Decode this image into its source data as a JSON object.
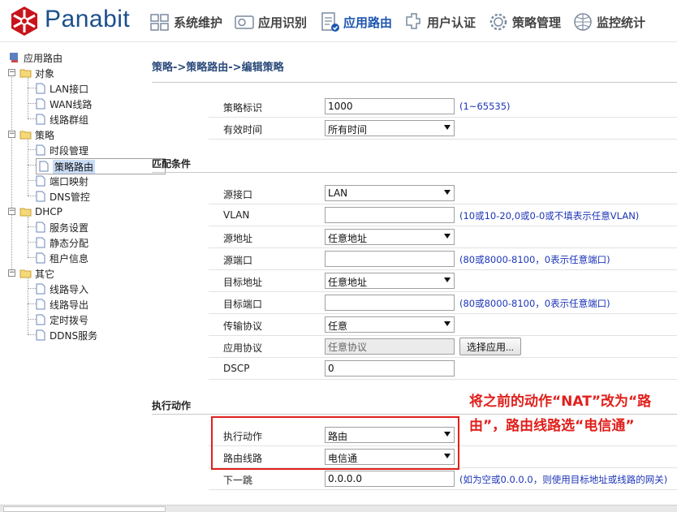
{
  "header": {
    "brand": "Panabit",
    "nav": [
      {
        "label": "系统维护",
        "icon": "system-icon"
      },
      {
        "label": "应用识别",
        "icon": "app-recognition-icon"
      },
      {
        "label": "应用路由",
        "icon": "app-routing-icon",
        "active": true
      },
      {
        "label": "用户认证",
        "icon": "user-auth-icon"
      },
      {
        "label": "策略管理",
        "icon": "policy-gear-icon"
      },
      {
        "label": "监控统计",
        "icon": "monitor-icon"
      }
    ]
  },
  "sidebar": {
    "root": "应用路由",
    "groups": [
      {
        "label": "对象",
        "items": [
          "LAN接口",
          "WAN线路",
          "线路群组"
        ]
      },
      {
        "label": "策略",
        "items": [
          "时段管理",
          "策略路由",
          "端口映射",
          "DNS管控"
        ]
      },
      {
        "label": "DHCP",
        "items": [
          "服务设置",
          "静态分配",
          "租户信息"
        ]
      },
      {
        "label": "其它",
        "items": [
          "线路导入",
          "线路导出",
          "定时拨号",
          "DDNS服务"
        ]
      }
    ],
    "selected": "策略路由"
  },
  "main": {
    "breadcrumb": "策略->策略路由->编辑策略",
    "basic": {
      "id_label": "策略标识",
      "id_value": "1000",
      "id_hint": "(1~65535)",
      "time_label": "有效时间",
      "time_value": "所有时间"
    },
    "match": {
      "title": "匹配条件",
      "src_iface_label": "源接口",
      "src_iface_value": "LAN",
      "vlan_label": "VLAN",
      "vlan_value": "",
      "vlan_hint": "(10或10-20,0或0-0或不填表示任意VLAN)",
      "src_addr_label": "源地址",
      "src_addr_value": "任意地址",
      "src_port_label": "源端口",
      "src_port_value": "",
      "src_port_hint": "(80或8000-8100，0表示任意端口)",
      "dst_addr_label": "目标地址",
      "dst_addr_value": "任意地址",
      "dst_port_label": "目标端口",
      "dst_port_value": "",
      "dst_port_hint": "(80或8000-8100，0表示任意端口)",
      "proto_label": "传输协议",
      "proto_value": "任意",
      "app_label": "应用协议",
      "app_value": "任意协议",
      "app_button": "选择应用...",
      "dscp_label": "DSCP",
      "dscp_value": "0"
    },
    "action": {
      "title": "执行动作",
      "action_label": "执行动作",
      "action_value": "路由",
      "line_label": "路由线路",
      "line_value": "电信通",
      "nexthop_label": "下一跳",
      "nexthop_value": "0.0.0.0",
      "nexthop_hint": "(如为空或0.0.0.0，则使用目标地址或线路的网关)"
    },
    "annotation": "将之前的动作“NAT”改为“路由”，路由线路选“电信通”"
  },
  "colors": {
    "accent": "#1e56b0",
    "annotation": "#e0201c",
    "hint": "#1d35b8"
  }
}
